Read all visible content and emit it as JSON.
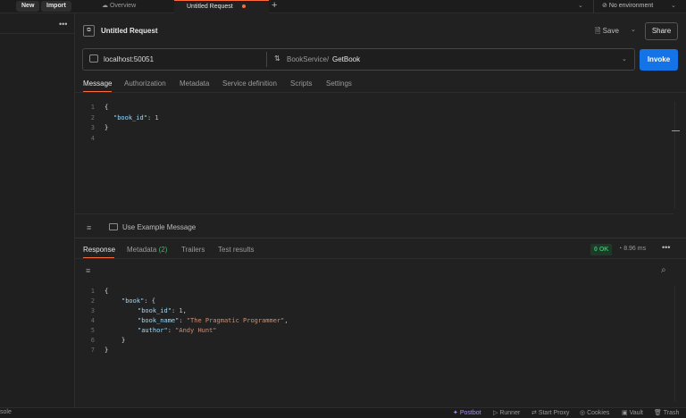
{
  "topbar": {
    "new_label": "New",
    "import_label": "Import",
    "tabs": [
      {
        "label": "Overview"
      },
      {
        "label": "Untitled Request"
      }
    ],
    "environment_label": "No environment"
  },
  "request": {
    "title": "Untitled Request",
    "save_label": "Save",
    "share_label": "Share",
    "url": "localhost:50051",
    "method_service": "BookService",
    "method_sep": "/",
    "method_name": "GetBook",
    "invoke_label": "Invoke",
    "tabs": [
      "Message",
      "Authorization",
      "Metadata",
      "Service definition",
      "Scripts",
      "Settings"
    ],
    "editor": {
      "line_numbers": [
        "1",
        "2",
        "3",
        "4"
      ],
      "key": "\"book_id\"",
      "value": "1"
    },
    "use_example_label": "Use Example Message"
  },
  "response": {
    "tabs": {
      "response": "Response",
      "metadata": "Metadata",
      "metadata_count": "(2)",
      "trailers": "Trailers",
      "tests": "Test results"
    },
    "status": "0 OK",
    "time": "8.96 ms",
    "editor": {
      "line_numbers": [
        "1",
        "2",
        "3",
        "4",
        "5",
        "6",
        "7"
      ],
      "book_key": "\"book\"",
      "book_id_key": "\"book_id\"",
      "book_id_value": "1",
      "book_name_key": "\"book_name\"",
      "book_name_value": "\"The Pragmatic Programmer\"",
      "author_key": "\"author\"",
      "author_value": "\"Andy Hunt\""
    }
  },
  "statusbar": {
    "console": "sole",
    "postbot": "Postbot",
    "runner": "Runner",
    "proxy": "Start Proxy",
    "cookies": "Cookies",
    "vault": "Vault",
    "trash": "Trash"
  },
  "colors": {
    "accent": "#ff6c37",
    "invoke": "#1473e6",
    "ok": "#3fba6b"
  }
}
